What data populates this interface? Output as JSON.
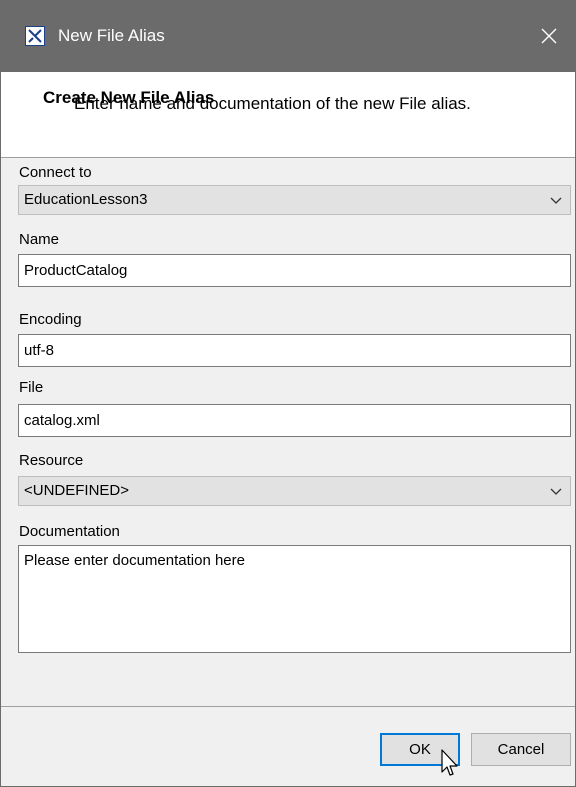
{
  "window": {
    "title": "New File Alias",
    "title_bar_color": "#6b6b6b",
    "icons": {
      "app": "app-icon",
      "close": "close-icon"
    }
  },
  "header": {
    "title": "Create New File Alias",
    "description": "Enter name and documentation of the new File alias."
  },
  "form": {
    "connect_to": {
      "label": "Connect to",
      "value": "EducationLesson3"
    },
    "name": {
      "label": "Name",
      "value": "ProductCatalog"
    },
    "encoding": {
      "label": "Encoding",
      "value": "utf-8"
    },
    "file": {
      "label": "File",
      "value": "catalog.xml"
    },
    "resource": {
      "label": "Resource",
      "value": "<UNDEFINED>"
    },
    "documentation": {
      "label": "Documentation",
      "value": "Please enter documentation here"
    }
  },
  "buttons": {
    "ok": "OK",
    "cancel": "Cancel",
    "focus_color": "#0078d7"
  }
}
